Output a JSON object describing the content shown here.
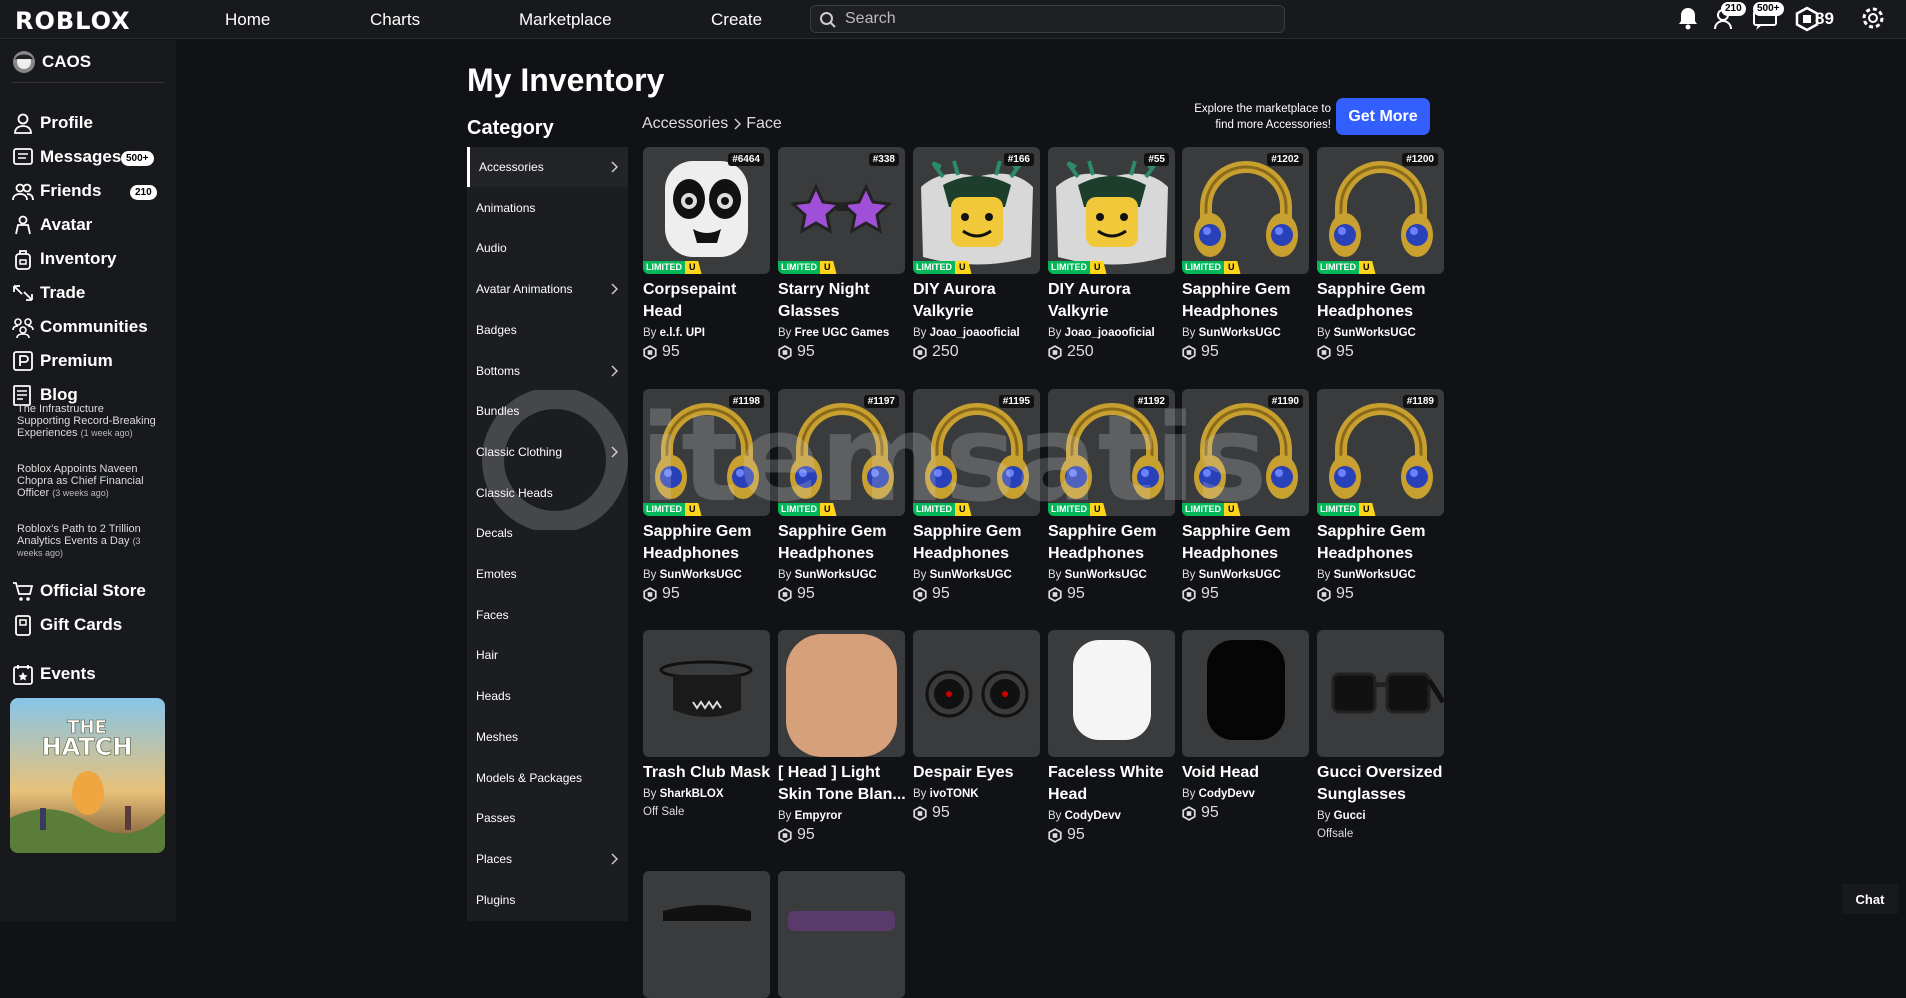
{
  "topbar": {
    "logo": "ROBLOX",
    "nav": [
      "Home",
      "Charts",
      "Marketplace",
      "Create"
    ],
    "search_placeholder": "Search",
    "friends_badge": "210",
    "messages_badge": "500+",
    "robux": "89"
  },
  "sidebar": {
    "username": "CAOS",
    "items": [
      {
        "label": "Profile",
        "icon": "person-icon"
      },
      {
        "label": "Messages",
        "icon": "messages-icon",
        "badge": "500+"
      },
      {
        "label": "Friends",
        "icon": "friends-icon",
        "badge": "210"
      },
      {
        "label": "Avatar",
        "icon": "avatar-icon"
      },
      {
        "label": "Inventory",
        "icon": "inventory-icon"
      },
      {
        "label": "Trade",
        "icon": "trade-icon"
      },
      {
        "label": "Communities",
        "icon": "communities-icon"
      },
      {
        "label": "Premium",
        "icon": "premium-icon"
      },
      {
        "label": "Blog",
        "icon": "blog-icon"
      }
    ],
    "blog_posts": [
      {
        "title": "The Infrastructure Supporting Record-Breaking Experiences",
        "ago": "(1 week ago)"
      },
      {
        "title": "Roblox Appoints Naveen Chopra as Chief Financial Officer",
        "ago": "(3 weeks ago)"
      },
      {
        "title": "Roblox's Path to 2 Trillion Analytics Events a Day",
        "ago": "(3 weeks ago)"
      }
    ],
    "bottom_items": [
      {
        "label": "Official Store",
        "icon": "store-icon"
      },
      {
        "label": "Gift Cards",
        "icon": "gift-card-icon"
      },
      {
        "label": "Events",
        "icon": "events-icon"
      }
    ],
    "event_banner": {
      "line1": "THE",
      "line2": "HATCH"
    }
  },
  "main": {
    "title": "My Inventory",
    "category_title": "Category",
    "breadcrumb": [
      "Accessories",
      "Face"
    ],
    "explore_text": "Explore the marketplace to find more Accessories!",
    "get_more": "Get More",
    "limited_label": "LIMITED",
    "limited_u": "U",
    "categories": [
      {
        "label": "Accessories",
        "chevron": true,
        "active": true
      },
      {
        "label": "Animations",
        "chevron": false
      },
      {
        "label": "Audio",
        "chevron": false
      },
      {
        "label": "Avatar Animations",
        "chevron": true
      },
      {
        "label": "Badges",
        "chevron": false
      },
      {
        "label": "Bottoms",
        "chevron": true
      },
      {
        "label": "Bundles",
        "chevron": false
      },
      {
        "label": "Classic Clothing",
        "chevron": true
      },
      {
        "label": "Classic Heads",
        "chevron": false
      },
      {
        "label": "Decals",
        "chevron": false
      },
      {
        "label": "Emotes",
        "chevron": false
      },
      {
        "label": "Faces",
        "chevron": false
      },
      {
        "label": "Hair",
        "chevron": false
      },
      {
        "label": "Heads",
        "chevron": false
      },
      {
        "label": "Meshes",
        "chevron": false
      },
      {
        "label": "Models & Packages",
        "chevron": false
      },
      {
        "label": "Passes",
        "chevron": false
      },
      {
        "label": "Places",
        "chevron": true
      },
      {
        "label": "Plugins",
        "chevron": false
      }
    ],
    "items": [
      {
        "name": "Corpsepaint Head",
        "by": "By",
        "creator": "e.l.f. UPI",
        "price": "95",
        "serial": "#6464",
        "limited": true,
        "thumb": "corpsepaint"
      },
      {
        "name": "Starry Night Glasses",
        "by": "By",
        "creator": "Free UGC Games",
        "price": "95",
        "serial": "#338",
        "limited": true,
        "thumb": "stars"
      },
      {
        "name": "DIY Aurora Valkyrie",
        "by": "By",
        "creator": "Joao_joaooficial",
        "price": "250",
        "serial": "#166",
        "limited": true,
        "thumb": "valkyrie"
      },
      {
        "name": "DIY Aurora Valkyrie",
        "by": "By",
        "creator": "Joao_joaooficial",
        "price": "250",
        "serial": "#55",
        "limited": true,
        "thumb": "valkyrie"
      },
      {
        "name": "Sapphire Gem Headphones",
        "by": "By",
        "creator": "SunWorksUGC",
        "price": "95",
        "serial": "#1202",
        "limited": true,
        "thumb": "headphones"
      },
      {
        "name": "Sapphire Gem Headphones",
        "by": "By",
        "creator": "SunWorksUGC",
        "price": "95",
        "serial": "#1200",
        "limited": true,
        "thumb": "headphones"
      },
      {
        "name": "Sapphire Gem Headphones",
        "by": "By",
        "creator": "SunWorksUGC",
        "price": "95",
        "serial": "#1198",
        "limited": true,
        "thumb": "headphones"
      },
      {
        "name": "Sapphire Gem Headphones",
        "by": "By",
        "creator": "SunWorksUGC",
        "price": "95",
        "serial": "#1197",
        "limited": true,
        "thumb": "headphones"
      },
      {
        "name": "Sapphire Gem Headphones",
        "by": "By",
        "creator": "SunWorksUGC",
        "price": "95",
        "serial": "#1195",
        "limited": true,
        "thumb": "headphones"
      },
      {
        "name": "Sapphire Gem Headphones",
        "by": "By",
        "creator": "SunWorksUGC",
        "price": "95",
        "serial": "#1192",
        "limited": true,
        "thumb": "headphones"
      },
      {
        "name": "Sapphire Gem Headphones",
        "by": "By",
        "creator": "SunWorksUGC",
        "price": "95",
        "serial": "#1190",
        "limited": true,
        "thumb": "headphones"
      },
      {
        "name": "Sapphire Gem Headphones",
        "by": "By",
        "creator": "SunWorksUGC",
        "price": "95",
        "serial": "#1189",
        "limited": true,
        "thumb": "headphones"
      },
      {
        "name": "Trash Club Mask",
        "by": "By",
        "creator": "SharkBLOX",
        "price": "",
        "offsale": "Off Sale",
        "serial": "",
        "limited": false,
        "thumb": "mask"
      },
      {
        "name": "[ Head ] Light Skin Tone Blan...",
        "by": "By",
        "creator": "Empyror",
        "price": "95",
        "serial": "",
        "limited": false,
        "thumb": "skinhead"
      },
      {
        "name": "Despair Eyes",
        "by": "By",
        "creator": "ivoTONK",
        "price": "95",
        "serial": "",
        "limited": false,
        "thumb": "eyes"
      },
      {
        "name": "Faceless White Head",
        "by": "By",
        "creator": "CodyDevv",
        "price": "95",
        "serial": "",
        "limited": false,
        "thumb": "whitehead"
      },
      {
        "name": "Void Head",
        "by": "By",
        "creator": "CodyDevv",
        "price": "95",
        "serial": "",
        "limited": false,
        "thumb": "voidhead"
      },
      {
        "name": "Gucci Oversized Sunglasses",
        "by": "By",
        "creator": "Gucci",
        "price": "",
        "offsale": "Offsale",
        "serial": "",
        "limited": false,
        "thumb": "sunglasses"
      },
      {
        "name": "",
        "by": "",
        "creator": "",
        "price": "",
        "serial": "",
        "limited": false,
        "thumb": "partial1"
      },
      {
        "name": "",
        "by": "",
        "creator": "",
        "price": "",
        "serial": "",
        "limited": false,
        "thumb": "partial2"
      }
    ]
  },
  "watermark": "itemsatis",
  "chat": "Chat"
}
